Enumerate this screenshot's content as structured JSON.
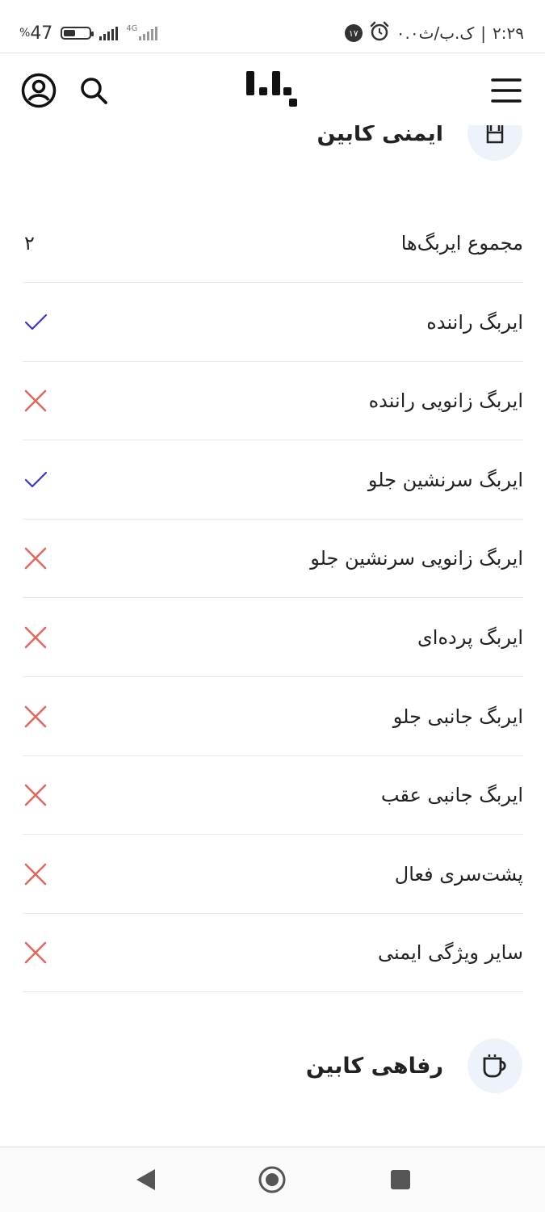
{
  "status_bar": {
    "battery_percent": "47",
    "percent_sign": "%",
    "network_type": "4G",
    "time": "۲:۲۹",
    "speed": "۰.۰ک.ب/ث",
    "notification_count": "۱۷",
    "battery_level": 0.47
  },
  "header": {
    "menu_icon": "hamburger-menu-icon",
    "logo_icon": "app-logo",
    "search_icon": "search-icon",
    "profile_icon": "user-profile-icon"
  },
  "safety_section": {
    "title": "ایمنی کابین",
    "icon": "seat-icon"
  },
  "features": [
    {
      "label": "مجموع ایربگ‌ها",
      "type": "value",
      "value": "۲"
    },
    {
      "label": "ایربگ راننده",
      "type": "check",
      "available": true
    },
    {
      "label": "ایربگ زانویی راننده",
      "type": "check",
      "available": false
    },
    {
      "label": "ایربگ سرنشین جلو",
      "type": "check",
      "available": true
    },
    {
      "label": "ایربگ زانویی سرنشین جلو",
      "type": "check",
      "available": false
    },
    {
      "label": "ایربگ پرده‌ای",
      "type": "check",
      "available": false
    },
    {
      "label": "ایربگ جانبی جلو",
      "type": "check",
      "available": false
    },
    {
      "label": "ایربگ جانبی عقب",
      "type": "check",
      "available": false
    },
    {
      "label": "پشت‌سری فعال",
      "type": "check",
      "available": false
    },
    {
      "label": "سایر ویژگی ایمنی",
      "type": "check",
      "available": false
    }
  ],
  "comfort_section": {
    "title": "رفاهی کابین",
    "icon": "coffee-cup-icon"
  },
  "colors": {
    "check": "#3a35c9",
    "cross": "#e0695f",
    "icon_bg": "#eef3fb"
  },
  "bottom_nav": {
    "back_icon": "back-triangle-icon",
    "home_icon": "home-circle-icon",
    "recents_icon": "recents-square-icon"
  }
}
